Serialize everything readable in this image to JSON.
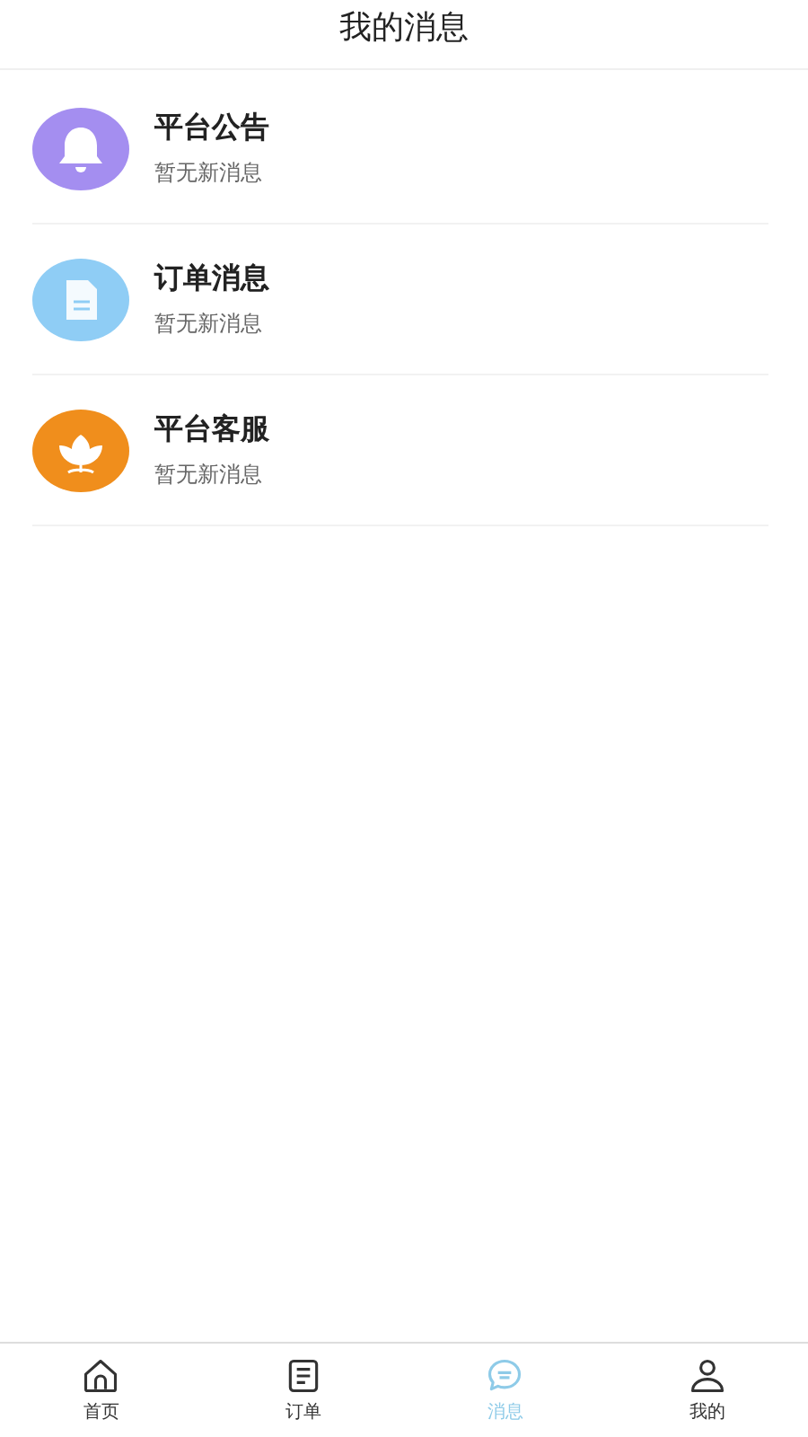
{
  "header": {
    "title": "我的消息"
  },
  "messages": [
    {
      "kind": "bell",
      "color": "#a48ef0",
      "title": "平台公告",
      "subtitle": "暂无新消息"
    },
    {
      "kind": "document",
      "color": "#8fcdf5",
      "title": "订单消息",
      "subtitle": "暂无新消息"
    },
    {
      "kind": "flower",
      "color": "#f08e1c",
      "title": "平台客服",
      "subtitle": "暂无新消息"
    }
  ],
  "tab_bar": [
    {
      "kind": "home",
      "label": "首页",
      "selected": false
    },
    {
      "kind": "list",
      "label": "订单",
      "selected": false
    },
    {
      "kind": "chat",
      "label": "消息",
      "selected": true
    },
    {
      "kind": "person",
      "label": "我的",
      "selected": false
    }
  ]
}
